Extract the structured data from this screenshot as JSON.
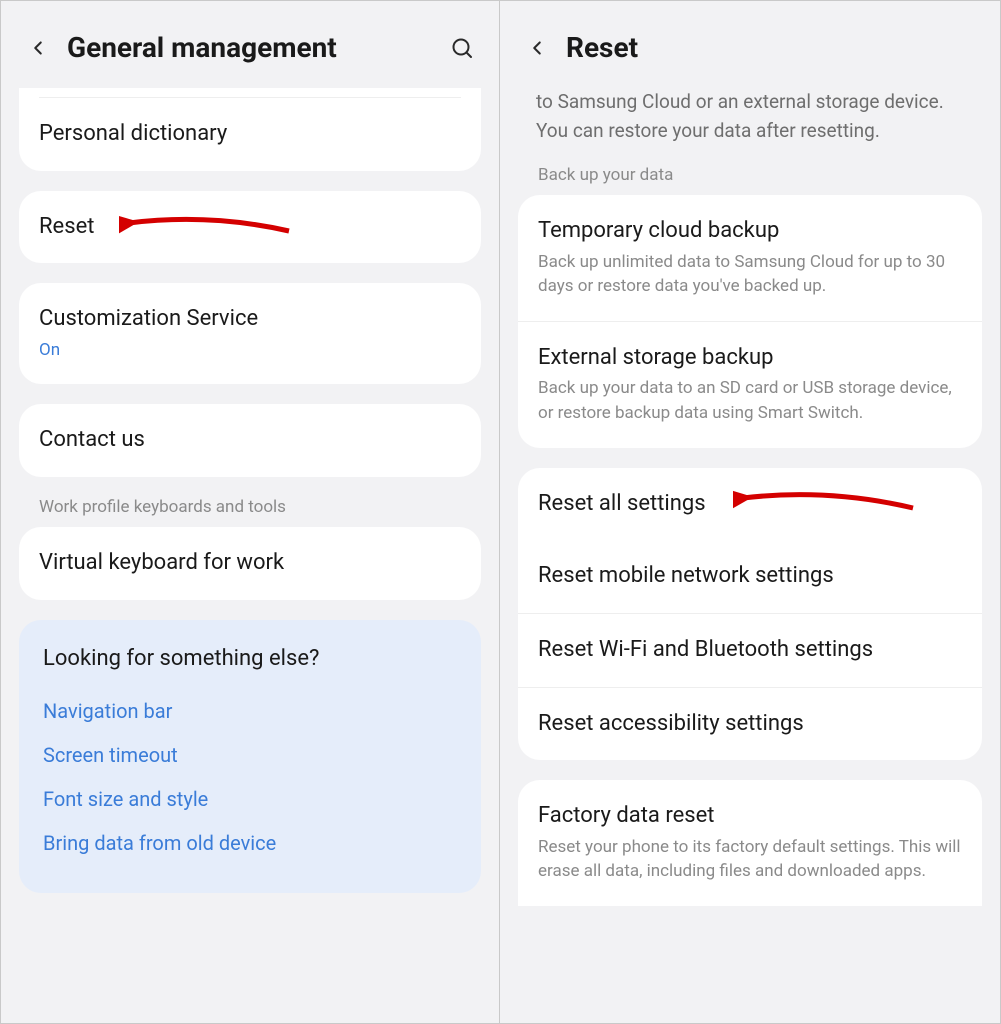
{
  "left": {
    "title": "General management",
    "personal_dictionary": "Personal dictionary",
    "reset": "Reset",
    "customization_service": {
      "label": "Customization Service",
      "status": "On"
    },
    "contact_us": "Contact us",
    "section_work": "Work profile keyboards and tools",
    "virtual_keyboard_work": "Virtual keyboard for work",
    "help": {
      "title": "Looking for something else?",
      "links": [
        "Navigation bar",
        "Screen timeout",
        "Font size and style",
        "Bring data from old device"
      ]
    }
  },
  "right": {
    "title": "Reset",
    "intro": "to Samsung Cloud or an external storage device. You can restore your data after resetting.",
    "section_backup": "Back up your data",
    "temp_cloud": {
      "label": "Temporary cloud backup",
      "sub": "Back up unlimited data to Samsung Cloud for up to 30 days or restore data you've backed up."
    },
    "external_storage": {
      "label": "External storage backup",
      "sub": "Back up your data to an SD card or USB storage device, or restore backup data using Smart Switch."
    },
    "reset_all": "Reset all settings",
    "reset_mobile": "Reset mobile network settings",
    "reset_wifi_bt": "Reset Wi-Fi and Bluetooth settings",
    "reset_accessibility": "Reset accessibility settings",
    "factory": {
      "label": "Factory data reset",
      "sub": "Reset your phone to its factory default settings. This will erase all data, including files and downloaded apps."
    }
  }
}
